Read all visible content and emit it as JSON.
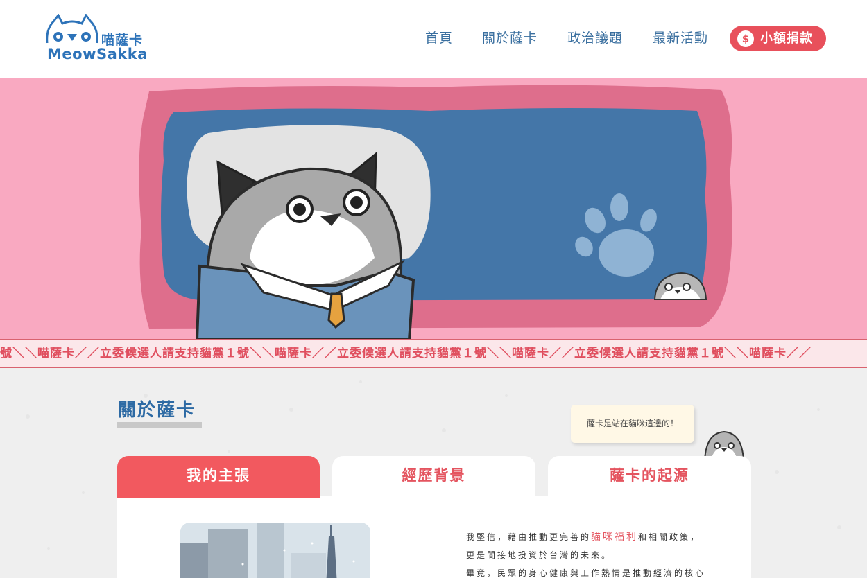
{
  "header": {
    "logo_cn": "喵薩卡",
    "logo_en": "MeowSakka",
    "nav": [
      "首頁",
      "關於薩卡",
      "政治議題",
      "最新活動"
    ],
    "donate_label": "小額捐款",
    "donate_icon": "$"
  },
  "ticker": {
    "text": "號＼＼喵薩卡／／立委候選人請支持貓黨１號＼＼喵薩卡／／立委候選人請支持貓黨１號＼＼喵薩卡／／立委候選人請支持貓黨１號＼＼喵薩卡／／"
  },
  "about": {
    "title": "關於薩卡",
    "bubble": "薩卡是站在貓咪這邊的！",
    "tabs": [
      "我的主張",
      "經歷背景",
      "薩卡的起源"
    ],
    "active_tab": 0,
    "para": {
      "line1_a": "我堅信，藉由推動更完善的",
      "line1_hl": "貓咪福利",
      "line1_b": "和相關政策，",
      "line2": "更是間接地投資於台灣的未來。",
      "line3": "畢竟，民眾的身心健康與工作熱情是推動經濟的核心"
    }
  },
  "colors": {
    "brand_blue": "#2d73b9",
    "accent_red": "#e8505b",
    "hero_pink": "#f9a9c1",
    "board_blue": "#4476a8"
  }
}
